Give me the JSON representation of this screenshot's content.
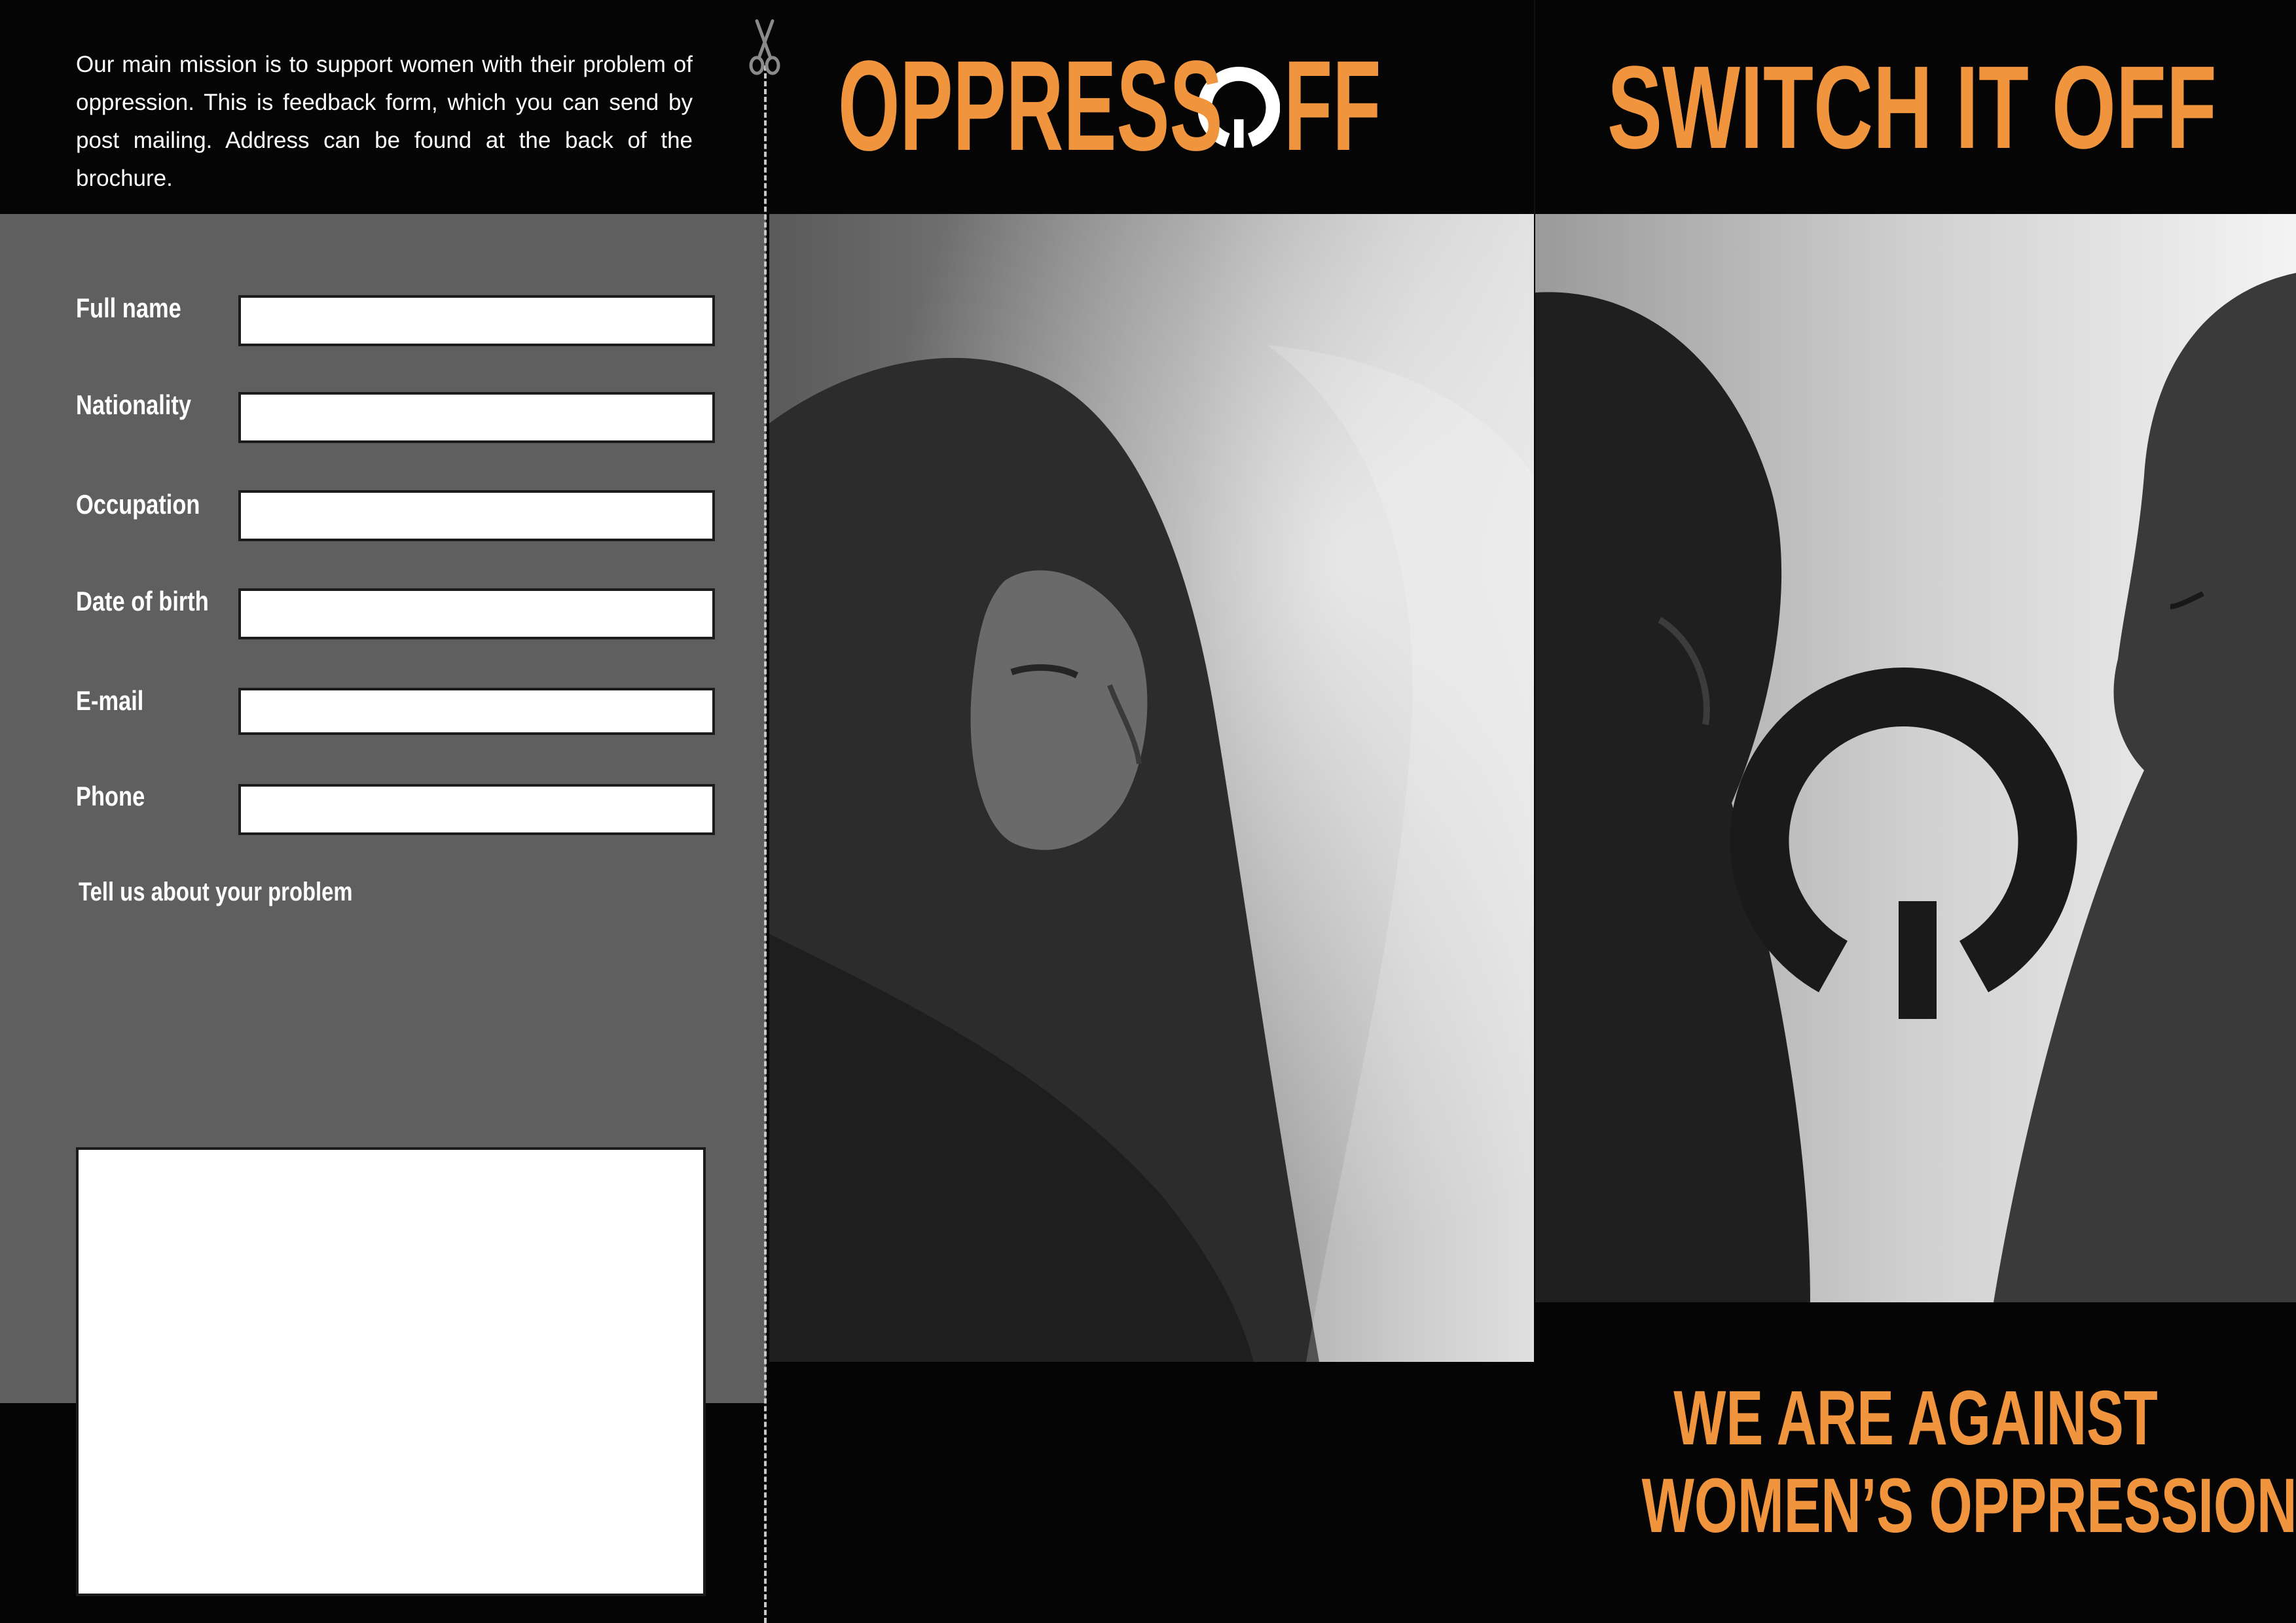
{
  "intro": {
    "text": "Our main mission is to support women with their problem of oppression. This is feedback form, which you can send by post mailing. Address can be found at the back of the brochure."
  },
  "form": {
    "fields": [
      {
        "label": "Full name",
        "value": ""
      },
      {
        "label": "Nationality",
        "value": ""
      },
      {
        "label": "Occupation",
        "value": ""
      },
      {
        "label": "Date of birth",
        "value": ""
      },
      {
        "label": "E-mail",
        "value": ""
      },
      {
        "label": "Phone",
        "value": ""
      }
    ],
    "problem_label": "Tell us about your problem",
    "problem_value": ""
  },
  "brand": {
    "logo_left": "OPPRESS",
    "logo_right": "FF",
    "accent_color": "#f0953d"
  },
  "right_panel": {
    "title": "SWITCH IT OFF",
    "tagline_line1": "WE ARE AGAINST",
    "tagline_line2": "WOMEN’S OPPRESSION"
  },
  "icons": {
    "cut": "scissors-icon",
    "logo": "power-symbol-icon"
  }
}
